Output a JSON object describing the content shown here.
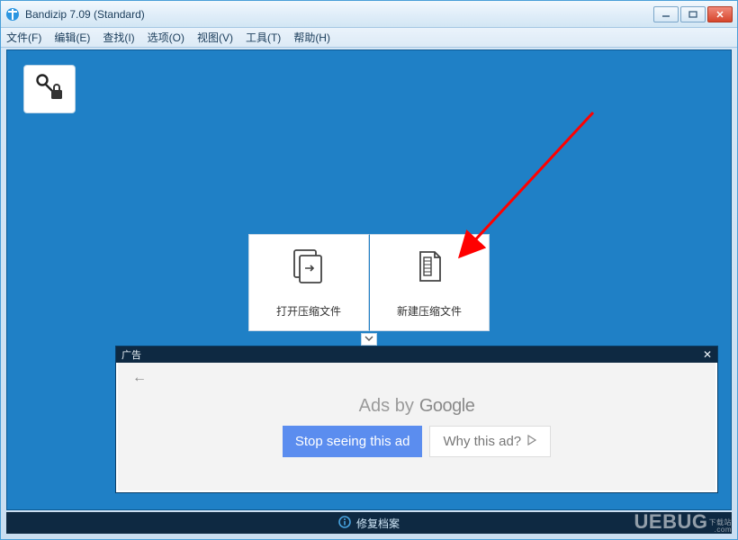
{
  "window": {
    "title": "Bandizip 7.09 (Standard)"
  },
  "menu": {
    "file": "文件(F)",
    "edit": "编辑(E)",
    "find": "查找(I)",
    "options": "选项(O)",
    "view": "视图(V)",
    "tools": "工具(T)",
    "help": "帮助(H)"
  },
  "actions": {
    "open_archive": "打开压缩文件",
    "new_archive": "新建压缩文件"
  },
  "ad": {
    "header": "广告",
    "title_prefix": "Ads by",
    "title_brand": "Google",
    "stop": "Stop seeing this ad",
    "why": "Why this ad?"
  },
  "status": {
    "repair": "修复档案"
  },
  "watermark": {
    "text": "UEBUG",
    "sub1": "下载站",
    "sub2": ".com"
  }
}
